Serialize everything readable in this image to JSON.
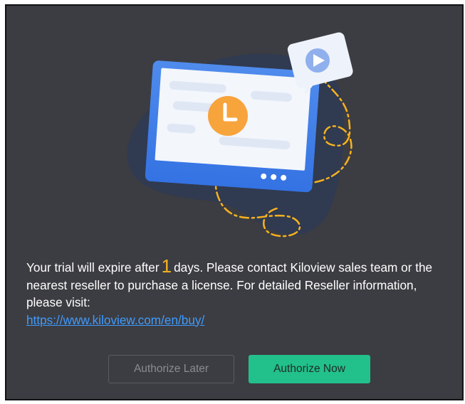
{
  "dialog": {
    "message": {
      "before": "Your trial will expire after",
      "days": "1",
      "after": "days. Please contact Kiloview sales team or the nearest reseller to purchase a license. For detailed Reseller information, please visit:",
      "link": "https://www.kiloview.com/en/buy/"
    },
    "buttons": {
      "later_label": "Authorize Later",
      "now_label": "Authorize Now"
    }
  },
  "colors": {
    "background": "#3c3d42",
    "accent": "#22c08a",
    "highlight": "#f7b21f",
    "link": "#3f9bff"
  },
  "icons": [
    "monitor-illustration",
    "clock-icon",
    "play-icon",
    "chat-bubble"
  ]
}
